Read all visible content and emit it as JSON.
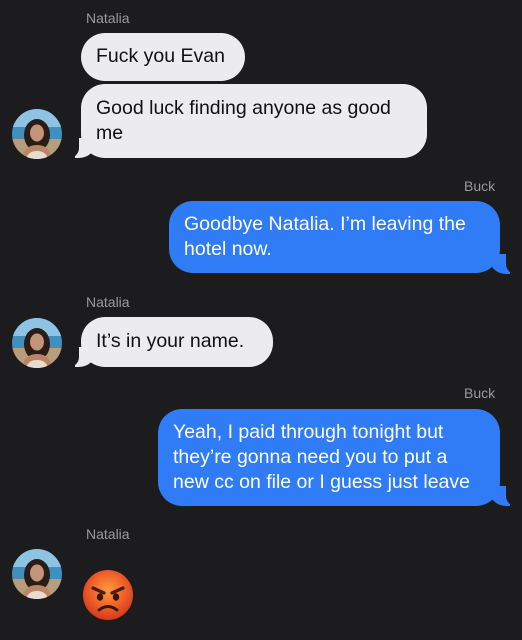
{
  "conversation": {
    "messages": [
      {
        "sender": "Natalia",
        "direction": "incoming",
        "text": "Fuck you Evan"
      },
      {
        "sender": "Natalia",
        "direction": "incoming",
        "text_lines": [
          "Good luck finding anyone as good",
          "me"
        ]
      },
      {
        "sender": "Buck",
        "direction": "outgoing",
        "text_lines": [
          "Goodbye Natalia. I’m leaving the",
          "hotel now."
        ]
      },
      {
        "sender": "Natalia",
        "direction": "incoming",
        "text": "It’s in your name."
      },
      {
        "sender": "Buck",
        "direction": "outgoing",
        "text_lines": [
          "Yeah, I paid through tonight but",
          "they’re gonna need you to put a",
          "new cc on file or I guess just leave"
        ]
      },
      {
        "sender": "Natalia",
        "direction": "incoming",
        "emoji": "angry-face-emoji"
      }
    ]
  },
  "colors": {
    "background": "#1c1c1e",
    "incoming_bubble": "#ececee",
    "outgoing_bubble": "#2f7cf6",
    "sender_label": "#9a9a9f"
  }
}
